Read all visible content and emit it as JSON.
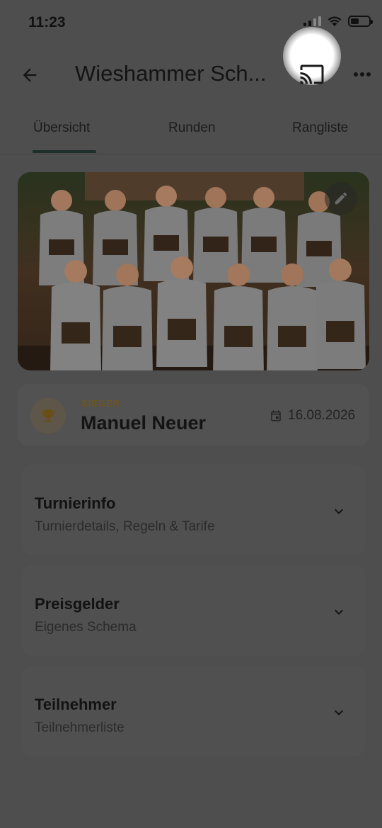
{
  "status_bar": {
    "time": "11:23"
  },
  "app_bar": {
    "title": "Wieshammer Sch..."
  },
  "tabs": [
    {
      "label": "Übersicht",
      "active": true
    },
    {
      "label": "Runden",
      "active": false
    },
    {
      "label": "Rangliste",
      "active": false
    }
  ],
  "winner": {
    "label": "SIEGER",
    "name": "Manuel Neuer",
    "date": "16.08.2026"
  },
  "sections": [
    {
      "title": "Turnierinfo",
      "subtitle": "Turnierdetails, Regeln & Tarife"
    },
    {
      "title": "Preisgelder",
      "subtitle": "Eigenes Schema"
    },
    {
      "title": "Teilnehmer",
      "subtitle": "Teilnehmerliste"
    }
  ],
  "colors": {
    "overlay": "#4e4e4e",
    "accent_gold": "#6b5523",
    "spotlight": "#ffffff"
  },
  "icons": [
    "back-arrow-icon",
    "cast-icon",
    "more-vert-icon",
    "edit-pencil-icon",
    "trophy-icon",
    "calendar-icon",
    "chevron-down-icon"
  ]
}
